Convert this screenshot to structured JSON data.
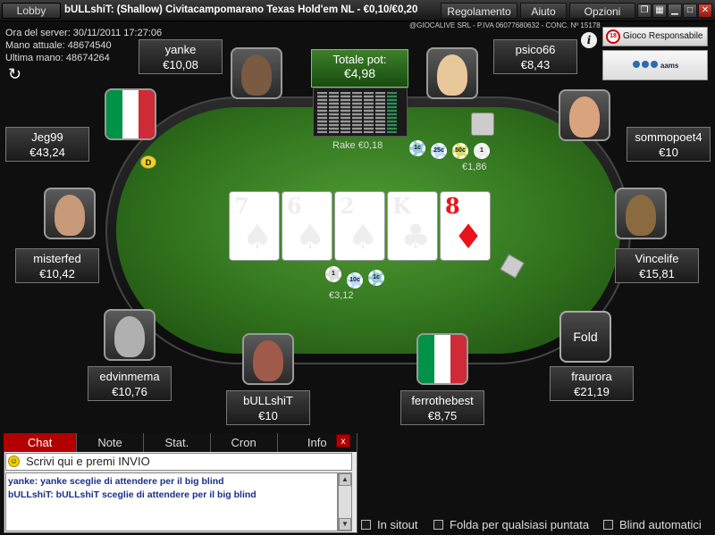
{
  "titlebar": {
    "lobby_label": "Lobby",
    "title": "bULLshiT: (Shallow) Civitacampomarano Texas Hold'em NL - €0,10/€0,20",
    "menu": [
      "Regolamento",
      "Aiuto",
      "Opzioni"
    ],
    "window_buttons": [
      "restore-icon",
      "tile-icon",
      "minimize-icon",
      "maximize-icon",
      "close-icon"
    ]
  },
  "info": {
    "server_time": "Ora del server: 30/11/2011 17:27:06",
    "current_hand": "Mano attuale: 48674540",
    "last_hand": "Ultima mano: 48674264",
    "company": "@GIOCALIVE SRL - P.IVA 06077680632 - CONC. Nº 15178",
    "gioco_responsabile": "Gioco Responsabile",
    "age_badge": "18",
    "logos_text": "aams"
  },
  "pot": {
    "label": "Totale pot:",
    "value": "€4,98",
    "rake": "Rake €0,18"
  },
  "board": [
    {
      "rank": "7",
      "suit": "♠",
      "color": "#000000"
    },
    {
      "rank": "6",
      "suit": "♠",
      "color": "#000000"
    },
    {
      "rank": "2",
      "suit": "♠",
      "color": "#000000"
    },
    {
      "rank": "K",
      "suit": "♣",
      "color": "#000000"
    },
    {
      "rank": "8",
      "suit": "♦",
      "color": "#e8131b"
    }
  ],
  "players": {
    "yanke": {
      "name": "yanke",
      "chips": "€10,08"
    },
    "psico66": {
      "name": "psico66",
      "chips": "€8,43"
    },
    "jeg99": {
      "name": "Jeg99",
      "chips": "€43,24"
    },
    "sommopoet4": {
      "name": "sommopoet4",
      "chips": "€10"
    },
    "misterfed": {
      "name": "misterfed",
      "chips": "€10,42"
    },
    "vincelife": {
      "name": "Vincelife",
      "chips": "€15,81"
    },
    "edvinmema": {
      "name": "edvinmema",
      "chips": "€10,76"
    },
    "bullshit": {
      "name": "bULLshiT",
      "chips": "€10"
    },
    "ferrothebest": {
      "name": "ferrothebest",
      "chips": "€8,75"
    },
    "fraurora": {
      "name": "fraurora",
      "chips": "€21,19"
    }
  },
  "fold_label": "Fold",
  "dealer_button": "D",
  "bets": {
    "right": {
      "amount": "€1,86",
      "chips": [
        "1c",
        "25c",
        "50c",
        "1"
      ]
    },
    "bottom": {
      "amount": "€3,12",
      "chips": [
        "1",
        "10c",
        "1c"
      ]
    }
  },
  "chat": {
    "tabs": [
      "Chat",
      "Note",
      "Stat.",
      "Cron",
      "Info"
    ],
    "close_label": "x",
    "input_placeholder": "Scrivi qui e premi INVIO",
    "messages": [
      "yanke: yanke sceglie di attendere per il big blind",
      "bULLshiT: bULLshiT sceglie di attendere per il big blind"
    ]
  },
  "options": {
    "sitout": "In sitout",
    "fold_any": "Folda per qualsiasi puntata",
    "auto_blinds": "Blind automatici"
  },
  "colors": {
    "felt": "#3d8a28",
    "chat_active_tab": "#b20000",
    "flag_green": "#009246",
    "flag_white": "#ffffff",
    "flag_red": "#ce2b37"
  }
}
